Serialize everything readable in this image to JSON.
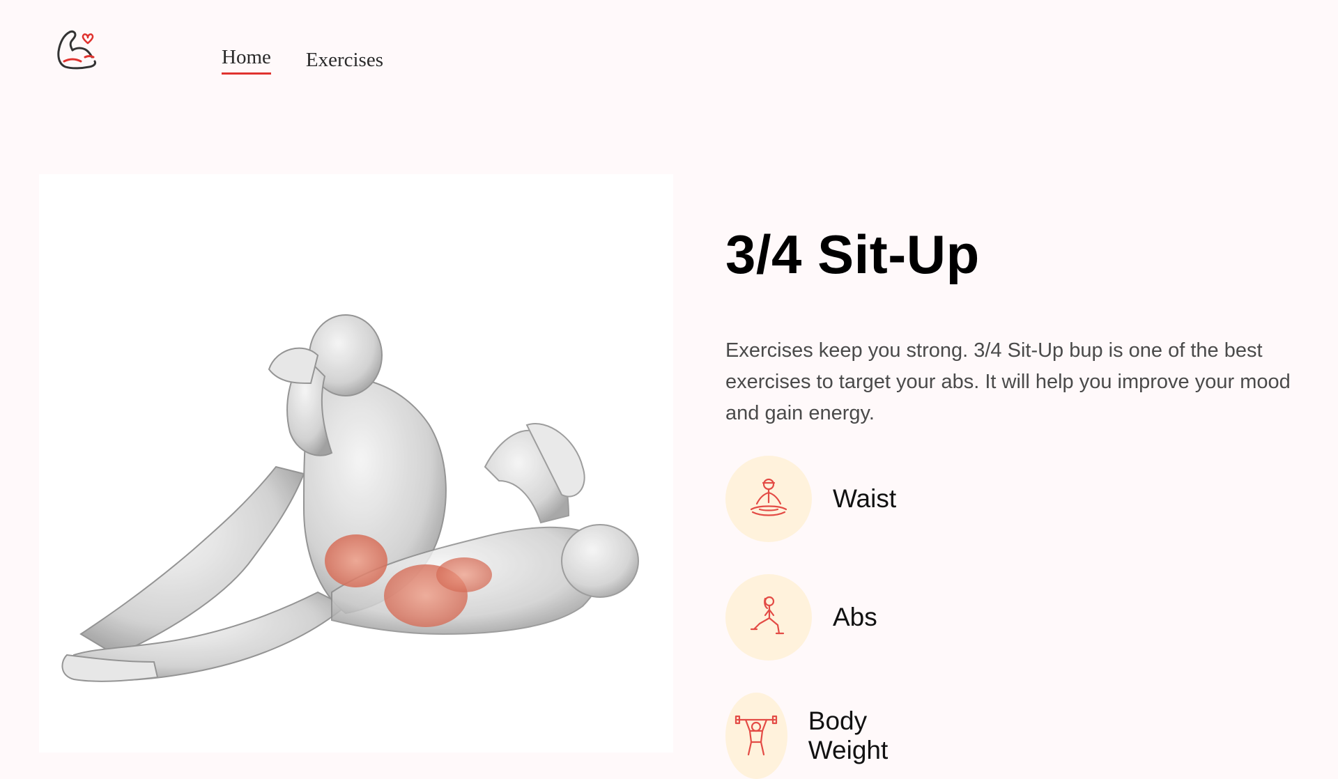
{
  "nav": {
    "logo_icon": "flexed-arm-heart-icon",
    "links": [
      {
        "label": "Home",
        "active": true
      },
      {
        "label": "Exercises",
        "active": false
      }
    ],
    "accent_color": "#e0332f"
  },
  "exercise": {
    "image_alt": "3/4 Sit-Up illustration",
    "title": "3/4 Sit-Up",
    "description": "Exercises keep you strong. 3/4 Sit-Up bup is one of the best exercises to target your abs. It will help you improve your mood and gain energy.",
    "tags": [
      {
        "label": "Waist",
        "icon": "meditation-pose-icon"
      },
      {
        "label": "Abs",
        "icon": "lunge-pose-icon"
      },
      {
        "label": "Body Weight",
        "icon": "weightlifter-icon"
      }
    ],
    "tag_circle_color": "#fff2dc"
  }
}
